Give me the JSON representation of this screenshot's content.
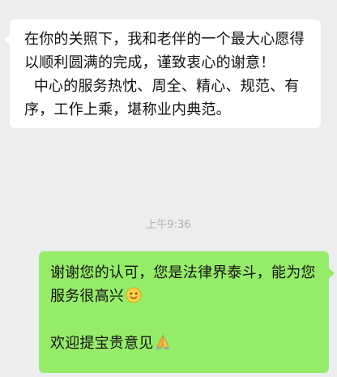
{
  "messages": [
    {
      "direction": "incoming",
      "paragraphs": [
        "在你的关照下，我和老伴的一个最大心愿得以顺利圆满的完成，谨致衷心的谢意！",
        "  中心的服务热忱、周全、精心、规范、有序，工作上乘，堪称业内典范。"
      ]
    },
    {
      "direction": "outgoing",
      "line1": "谢谢您的认可，您是法律界泰斗，能为您服务很高兴",
      "line1_emoji": "smile-emoji-icon",
      "line2": "欢迎提宝贵意见",
      "line2_emoji": "folded-hands-emoji-icon"
    }
  ],
  "timestamp": "上午9:36",
  "colors": {
    "background": "#ededed",
    "incoming_bubble": "#ffffff",
    "outgoing_bubble": "#95ec69",
    "timestamp": "#b2b2b2"
  }
}
